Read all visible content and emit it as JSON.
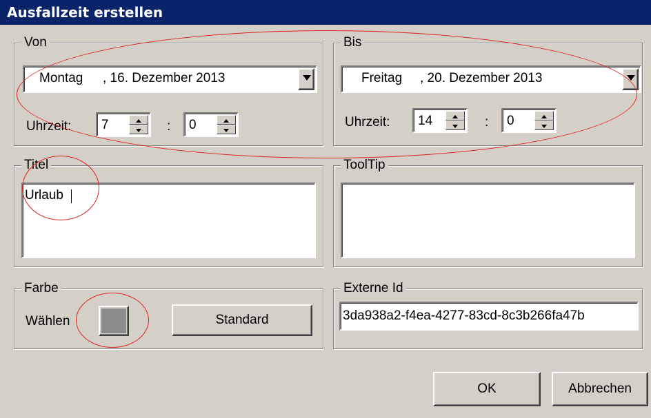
{
  "window": {
    "title": "Ausfallzeit erstellen"
  },
  "von": {
    "legend": "Von",
    "weekday": "Montag",
    "date": ", 16. Dezember 2013",
    "time_label": "Uhrzeit:",
    "hour": "7",
    "separator": ":",
    "minute": "0"
  },
  "bis": {
    "legend": "Bis",
    "weekday": "Freitag",
    "date": ", 20. Dezember 2013",
    "time_label": "Uhrzeit:",
    "hour": "14",
    "separator": ":",
    "minute": "0"
  },
  "titel": {
    "legend": "Titel",
    "value": "Urlaub"
  },
  "tooltip": {
    "legend": "ToolTip",
    "value": ""
  },
  "farbe": {
    "legend": "Farbe",
    "choose_label": "Wählen",
    "swatch_color": "#8c8c8c",
    "standard_button": "Standard"
  },
  "externe_id": {
    "legend": "Externe Id",
    "value": "3da938a2-f4ea-4277-83cd-8c3b266fa47b"
  },
  "actions": {
    "ok": "OK",
    "cancel": "Abbrechen"
  },
  "colors": {
    "titlebar": "#0a246a",
    "dialog_bg": "#d4d0c8",
    "annotation": "#e02020"
  }
}
